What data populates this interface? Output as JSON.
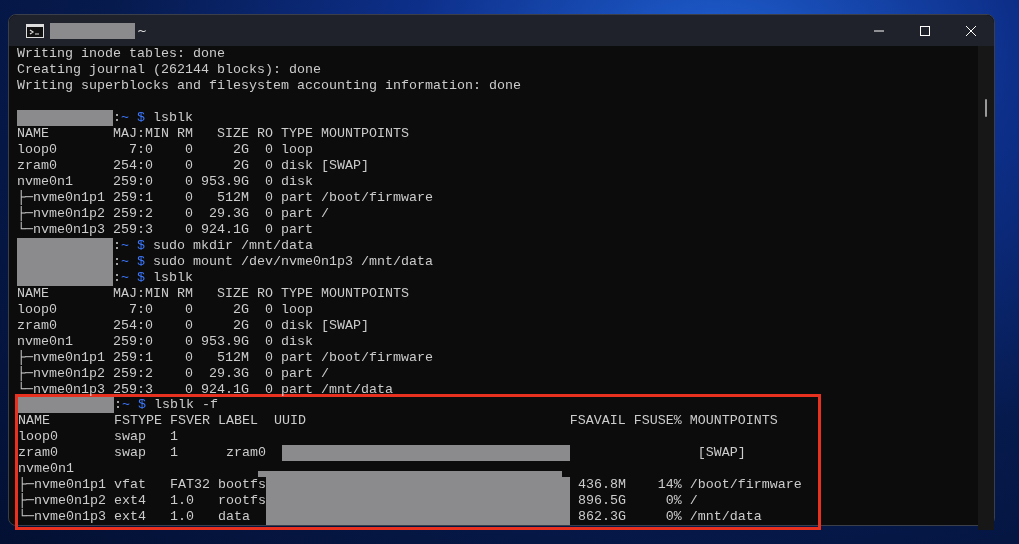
{
  "window": {
    "title": "~"
  },
  "lines": [
    {
      "kind": "output",
      "text": "Writing inode tables: done"
    },
    {
      "kind": "output",
      "text": "Creating journal (262144 blocks): done"
    },
    {
      "kind": "output",
      "text": "Writing superblocks and filesystem accounting information: done"
    },
    {
      "kind": "blank"
    },
    {
      "kind": "prompt",
      "sep": ":",
      "cwd": "~",
      "sigil": "$",
      "command": "lsblk"
    },
    {
      "kind": "output",
      "text": "NAME        MAJ:MIN RM   SIZE RO TYPE MOUNTPOINTS"
    },
    {
      "kind": "output",
      "text": "loop0         7:0    0     2G  0 loop"
    },
    {
      "kind": "output",
      "text": "zram0       254:0    0     2G  0 disk [SWAP]"
    },
    {
      "kind": "output",
      "text": "nvme0n1     259:0    0 953.9G  0 disk"
    },
    {
      "kind": "output",
      "text": "├─nvme0n1p1 259:1    0   512M  0 part /boot/firmware"
    },
    {
      "kind": "output",
      "text": "├─nvme0n1p2 259:2    0  29.3G  0 part /"
    },
    {
      "kind": "output",
      "text": "└─nvme0n1p3 259:3    0 924.1G  0 part"
    },
    {
      "kind": "prompt",
      "sep": ":",
      "cwd": "~",
      "sigil": "$",
      "command": "sudo mkdir /mnt/data"
    },
    {
      "kind": "prompt",
      "sep": ":",
      "cwd": "~",
      "sigil": "$",
      "command": "sudo mount /dev/nvme0n1p3 /mnt/data"
    },
    {
      "kind": "prompt",
      "sep": ":",
      "cwd": "~",
      "sigil": "$",
      "command": "lsblk"
    },
    {
      "kind": "output",
      "text": "NAME        MAJ:MIN RM   SIZE RO TYPE MOUNTPOINTS"
    },
    {
      "kind": "output",
      "text": "loop0         7:0    0     2G  0 loop"
    },
    {
      "kind": "output",
      "text": "zram0       254:0    0     2G  0 disk [SWAP]"
    },
    {
      "kind": "output",
      "text": "nvme0n1     259:0    0 953.9G  0 disk"
    },
    {
      "kind": "output",
      "text": "├─nvme0n1p1 259:1    0   512M  0 part /boot/firmware"
    },
    {
      "kind": "output",
      "text": "├─nvme0n1p2 259:2    0  29.3G  0 part /"
    },
    {
      "kind": "output",
      "text": "└─nvme0n1p3 259:3    0 924.1G  0 part /mnt/data"
    }
  ],
  "highlighted_lines": [
    {
      "kind": "prompt",
      "sep": ":",
      "cwd": "~",
      "sigil": "$",
      "command": "lsblk -f"
    },
    {
      "kind": "output",
      "text": "NAME        FSTYPE FSVER LABEL  UUID                                 FSAVAIL FSUSE% MOUNTPOINTS"
    },
    {
      "kind": "output",
      "text": "loop0       swap   1"
    },
    {
      "kind": "row",
      "segments": [
        {
          "kind": "text",
          "text": "zram0       swap   1      zram0  "
        },
        {
          "kind": "redacted-uuid"
        },
        {
          "kind": "text",
          "text": "                [SWAP]"
        }
      ]
    },
    {
      "kind": "row",
      "segments": [
        {
          "kind": "text",
          "text": "nvme0n1     "
        },
        {
          "kind": "redacted-top"
        }
      ]
    },
    {
      "kind": "row",
      "segments": [
        {
          "kind": "text",
          "text": "├─nvme0n1p1 vfat   FAT32 bootfs "
        },
        {
          "kind": "redacted-wide"
        },
        {
          "kind": "text",
          "text": " 436.8M    14% /boot/firmware"
        }
      ]
    },
    {
      "kind": "row",
      "segments": [
        {
          "kind": "text",
          "text": "├─nvme0n1p2 ext4   1.0   rootfs "
        },
        {
          "kind": "redacted-wide"
        },
        {
          "kind": "text",
          "text": " 896.5G     0% /"
        }
      ]
    },
    {
      "kind": "row",
      "segments": [
        {
          "kind": "text",
          "text": "└─nvme0n1p3 ext4   1.0   data   "
        },
        {
          "kind": "redacted-wide"
        },
        {
          "kind": "text",
          "text": " 862.3G     0% /mnt/data"
        }
      ]
    }
  ]
}
